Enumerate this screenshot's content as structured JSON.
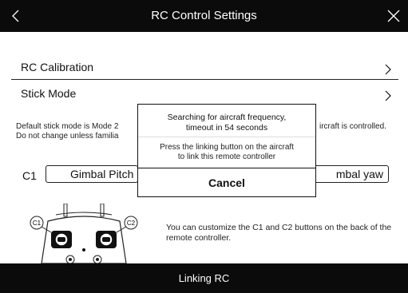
{
  "header": {
    "title": "RC Control Settings",
    "back_icon": "chevron-left-icon",
    "close_icon": "close-icon"
  },
  "menu": {
    "calibration_label": "RC Calibration",
    "stick_mode_label": "Stick Mode"
  },
  "description": {
    "line1_left": "Default stick mode is Mode 2",
    "line1_right": "ircraft is controlled.",
    "line2_left": "Do not change unless familia"
  },
  "buttons": {
    "c1_label": "C1",
    "c1_value": "Gimbal Pitch",
    "c2_value": "mbal yaw",
    "c1_badge": "C1",
    "c2_badge": "C2"
  },
  "hint": "You can customize the C1 and C2 buttons on the back of the remote controller.",
  "dialog": {
    "searching_line1": "Searching for aircraft frequency,",
    "searching_line2": "timeout in 54 seconds",
    "instruction_line1": "Press the linking button on the aircraft",
    "instruction_line2": "to link this remote controller",
    "cancel_label": "Cancel"
  },
  "footer": {
    "label": "Linking RC"
  }
}
